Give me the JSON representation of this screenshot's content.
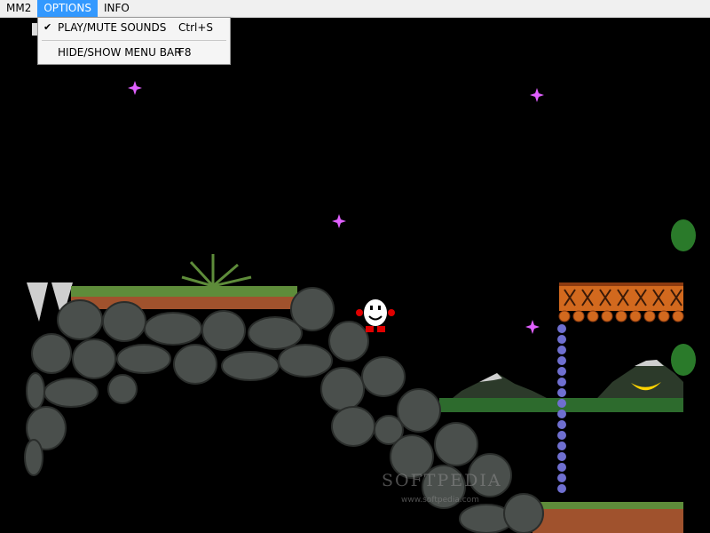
{
  "menubar": {
    "items": [
      {
        "label": "MM2"
      },
      {
        "label": "OPTIONS"
      },
      {
        "label": "INFO"
      }
    ]
  },
  "options_menu": {
    "items": [
      {
        "label": "PLAY/MUTE SOUNDS",
        "shortcut": "Ctrl+S",
        "checked": true,
        "check_mark": "✔"
      },
      {
        "label": "HIDE/SHOW MENU BAR",
        "shortcut": "F8",
        "checked": false
      }
    ]
  },
  "game": {
    "character": "dizzy-egg",
    "scene": "night-cave-arch-with-wooden-bridge",
    "colors": {
      "sky": "#000000",
      "rock": "#4a4f4c",
      "grass": "#5e8c3a",
      "dirt": "#a0522d",
      "bridge": "#d2691e",
      "star": "#e060ff",
      "chain": "#6f6fd0"
    }
  },
  "watermark": {
    "text": "SOFTPEDIA",
    "url": "www.softpedia.com"
  }
}
